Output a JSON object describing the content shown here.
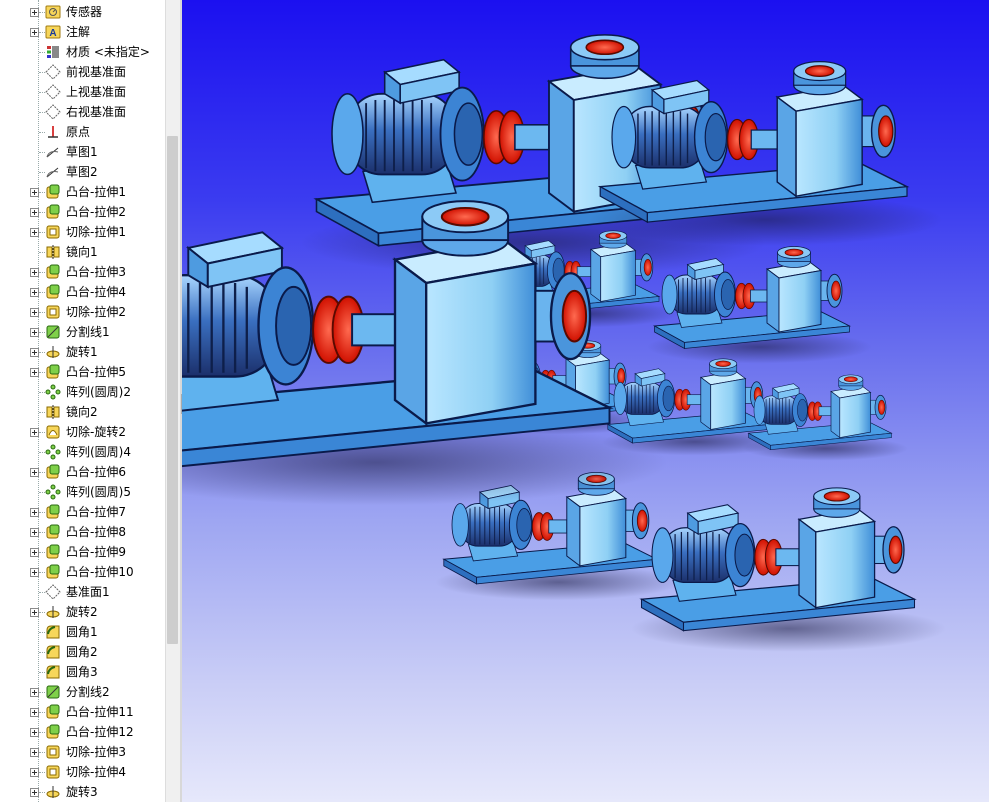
{
  "feature_tree": {
    "items": [
      {
        "label": "传感器",
        "icon": "sensor-folder-icon",
        "expandable": true
      },
      {
        "label": "注解",
        "icon": "annotation-icon",
        "expandable": true
      },
      {
        "label": "材质 <未指定>",
        "icon": "material-icon",
        "expandable": false
      },
      {
        "label": "前视基准面",
        "icon": "plane-icon",
        "expandable": false
      },
      {
        "label": "上视基准面",
        "icon": "plane-icon",
        "expandable": false
      },
      {
        "label": "右视基准面",
        "icon": "plane-icon",
        "expandable": false
      },
      {
        "label": "原点",
        "icon": "origin-icon",
        "expandable": false
      },
      {
        "label": "草图1",
        "icon": "sketch-icon",
        "expandable": false
      },
      {
        "label": "草图2",
        "icon": "sketch-icon",
        "expandable": false
      },
      {
        "label": "凸台-拉伸1",
        "icon": "boss-extrude-icon",
        "expandable": true
      },
      {
        "label": "凸台-拉伸2",
        "icon": "boss-extrude-icon",
        "expandable": true
      },
      {
        "label": "切除-拉伸1",
        "icon": "cut-extrude-icon",
        "expandable": true
      },
      {
        "label": "镜向1",
        "icon": "mirror-icon",
        "expandable": false
      },
      {
        "label": "凸台-拉伸3",
        "icon": "boss-extrude-icon",
        "expandable": true
      },
      {
        "label": "凸台-拉伸4",
        "icon": "boss-extrude-icon",
        "expandable": true
      },
      {
        "label": "切除-拉伸2",
        "icon": "cut-extrude-icon",
        "expandable": true
      },
      {
        "label": "分割线1",
        "icon": "split-line-icon",
        "expandable": true
      },
      {
        "label": "旋转1",
        "icon": "revolve-icon",
        "expandable": true
      },
      {
        "label": "凸台-拉伸5",
        "icon": "boss-extrude-icon",
        "expandable": true
      },
      {
        "label": "阵列(圆周)2",
        "icon": "circular-pattern-icon",
        "expandable": false
      },
      {
        "label": "镜向2",
        "icon": "mirror-icon",
        "expandable": false
      },
      {
        "label": "切除-旋转2",
        "icon": "cut-revolve-icon",
        "expandable": true
      },
      {
        "label": "阵列(圆周)4",
        "icon": "circular-pattern-icon",
        "expandable": false
      },
      {
        "label": "凸台-拉伸6",
        "icon": "boss-extrude-icon",
        "expandable": true
      },
      {
        "label": "阵列(圆周)5",
        "icon": "circular-pattern-icon",
        "expandable": false
      },
      {
        "label": "凸台-拉伸7",
        "icon": "boss-extrude-icon",
        "expandable": true
      },
      {
        "label": "凸台-拉伸8",
        "icon": "boss-extrude-icon",
        "expandable": true
      },
      {
        "label": "凸台-拉伸9",
        "icon": "boss-extrude-icon",
        "expandable": true
      },
      {
        "label": "凸台-拉伸10",
        "icon": "boss-extrude-icon",
        "expandable": true
      },
      {
        "label": "基准面1",
        "icon": "plane-icon",
        "expandable": false
      },
      {
        "label": "旋转2",
        "icon": "revolve-icon",
        "expandable": true
      },
      {
        "label": "圆角1",
        "icon": "fillet-icon",
        "expandable": false
      },
      {
        "label": "圆角2",
        "icon": "fillet-icon",
        "expandable": false
      },
      {
        "label": "圆角3",
        "icon": "fillet-icon",
        "expandable": false
      },
      {
        "label": "分割线2",
        "icon": "split-line-icon",
        "expandable": true
      },
      {
        "label": "凸台-拉伸11",
        "icon": "boss-extrude-icon",
        "expandable": true
      },
      {
        "label": "凸台-拉伸12",
        "icon": "boss-extrude-icon",
        "expandable": true
      },
      {
        "label": "切除-拉伸3",
        "icon": "cut-extrude-icon",
        "expandable": true
      },
      {
        "label": "切除-拉伸4",
        "icon": "cut-extrude-icon",
        "expandable": true
      },
      {
        "label": "旋转3",
        "icon": "revolve-icon",
        "expandable": true
      }
    ]
  },
  "colors": {
    "viewport_top": "#1b10f0",
    "viewport_bottom": "#e6e8fb",
    "pump_body": "#8fd0f4",
    "pump_shade": "#3f8ed8",
    "pump_outline": "#0a1a4a",
    "flange_red": "#ff2a1a",
    "motor_dark": "#2a4a8a"
  },
  "viewport": {
    "model_instances": 11
  }
}
